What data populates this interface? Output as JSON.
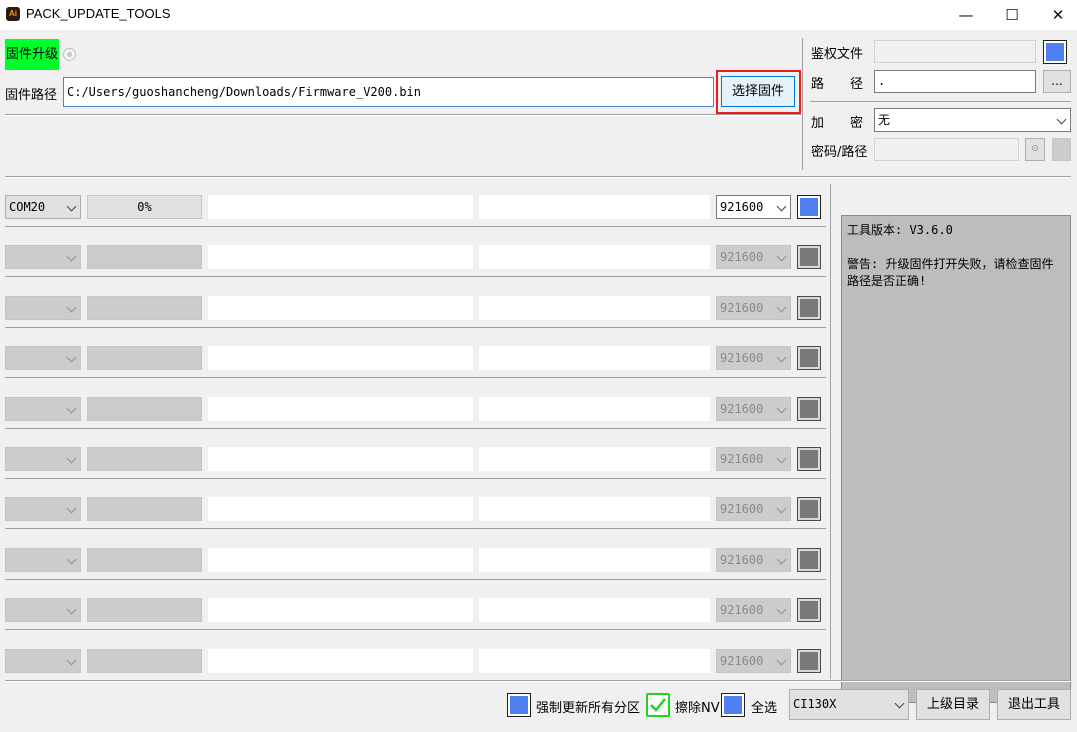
{
  "window": {
    "title": "PACK_UPDATE_TOOLS",
    "app_icon_text": "Ai",
    "minimize_glyph": "—",
    "maximize_glyph": "☐",
    "close_glyph": "✕"
  },
  "firmware": {
    "upgrade_label": "固件升级",
    "path_label": "固件路径",
    "path_value": "C:/Users/guoshancheng/Downloads/Firmware_V200.bin",
    "select_button": "选择固件"
  },
  "auth": {
    "auth_file_label": "鉴权文件",
    "path_label": "路　　径",
    "path_value": ".",
    "browse_button": "...",
    "encrypt_label": "加　　密",
    "encrypt_value": "无",
    "password_label": "密码/路径",
    "password_value": ""
  },
  "ports": [
    {
      "port": "COM20",
      "progress": "0%",
      "baud": "921600",
      "enabled": true
    },
    {
      "port": "",
      "progress": "",
      "baud": "921600",
      "enabled": false
    },
    {
      "port": "",
      "progress": "",
      "baud": "921600",
      "enabled": false
    },
    {
      "port": "",
      "progress": "",
      "baud": "921600",
      "enabled": false
    },
    {
      "port": "",
      "progress": "",
      "baud": "921600",
      "enabled": false
    },
    {
      "port": "",
      "progress": "",
      "baud": "921600",
      "enabled": false
    },
    {
      "port": "",
      "progress": "",
      "baud": "921600",
      "enabled": false
    },
    {
      "port": "",
      "progress": "",
      "baud": "921600",
      "enabled": false
    },
    {
      "port": "",
      "progress": "",
      "baud": "921600",
      "enabled": false
    },
    {
      "port": "",
      "progress": "",
      "baud": "921600",
      "enabled": false
    }
  ],
  "log": {
    "version_line": "工具版本: V3.6.0",
    "warning_line": "警告: 升级固件打开失败，请检查固件路径是否正确!"
  },
  "footer": {
    "force_update_label": "强制更新所有分区",
    "erase_nv_label": "擦除NV",
    "select_all_label": "全选",
    "chip_value": "CI130X",
    "parent_dir_button": "上级目录",
    "exit_button": "退出工具"
  },
  "colors": {
    "highlight_green": "#00ff2a",
    "checkbox_blue": "#4f7ff0",
    "focus_red": "#e81e1e"
  }
}
